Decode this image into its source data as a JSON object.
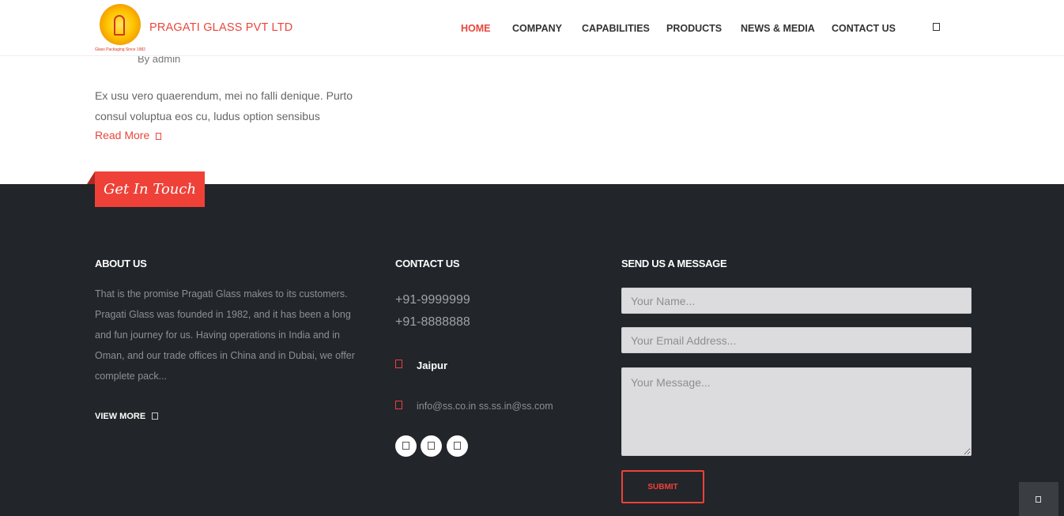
{
  "header": {
    "logo_tagline": "Glass Packaging Since 1982",
    "brand": "PRAGATI GLASS PVT LTD",
    "nav": [
      "HOME",
      "COMPANY",
      "CAPABILITIES",
      "PRODUCTS",
      "NEWS & MEDIA",
      "CONTACT US"
    ],
    "search_icon": "search-icon"
  },
  "post": {
    "author": "By admin",
    "excerpt": "Ex usu vero quaerendum, mei no falli denique. Purto consul voluptua eos cu, ludus option sensibus",
    "read_more": "Read More"
  },
  "footer": {
    "get_in_touch": "Get In Touch",
    "about": {
      "title": "ABOUT US",
      "text": "That is the promise Pragati Glass makes to its customers. Pragati Glass was founded in 1982, and it has been a long and fun journey for us. Having operations in India and in Oman, and our trade offices in China and in Dubai, we offer complete pack...",
      "view_more": "VIEW MORE"
    },
    "contact": {
      "title": "CONTACT US",
      "phones": [
        "+91-9999999",
        "+91-8888888"
      ],
      "city": "Jaipur",
      "email": "info@ss.co.in ss.ss.in@ss.com",
      "social_icons": [
        "facebook-icon",
        "twitter-icon",
        "linkedin-icon"
      ]
    },
    "message": {
      "title": "SEND US A MESSAGE",
      "name_placeholder": "Your Name...",
      "email_placeholder": "Your Email Address...",
      "message_placeholder": "Your Message...",
      "submit": "SUBMIT"
    }
  },
  "colors": {
    "accent": "#ef4138",
    "footer_bg": "#22252a"
  }
}
